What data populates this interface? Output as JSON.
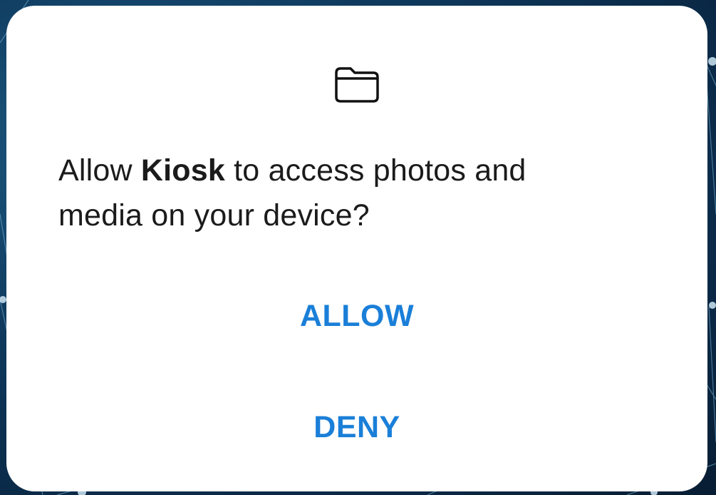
{
  "dialog": {
    "icon": "folder-icon",
    "message_prefix": "Allow ",
    "app_name": "Kiosk",
    "message_suffix": " to access photos and media on your device?",
    "allow_label": "ALLOW",
    "deny_label": "DENY"
  },
  "colors": {
    "accent": "#1a7fd8",
    "text": "#1b1b1b",
    "dialog_background": "#ffffff",
    "backdrop": "#0f3a5e"
  }
}
